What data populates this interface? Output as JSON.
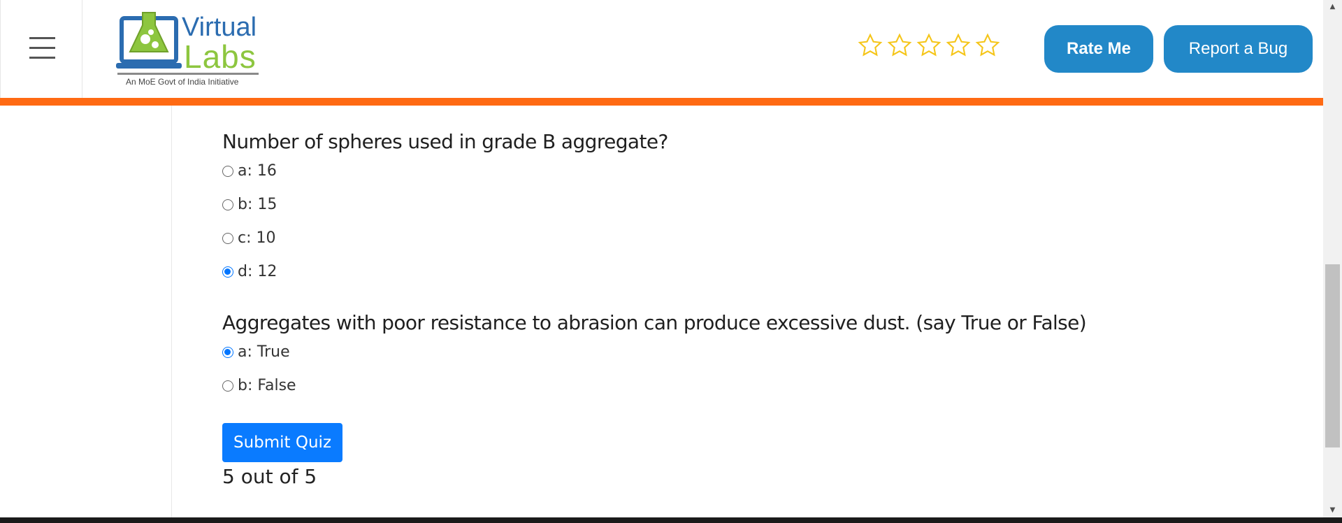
{
  "header": {
    "logo": {
      "word1": "Virtual",
      "word2": "Labs",
      "tagline": "An MoE Govt of India Initiative"
    },
    "rating": {
      "stars_total": 5,
      "stars_filled": 0,
      "star_color": "#f5c518"
    },
    "rate_button": "Rate Me",
    "bug_button": "Report a Bug",
    "accent_color": "#ff6a13",
    "button_color": "#2288c8"
  },
  "quiz": {
    "questions": [
      {
        "text": "Number of spheres used in grade B aggregate?",
        "options": [
          {
            "label": "a: 16",
            "selected": false
          },
          {
            "label": "b: 15",
            "selected": false
          },
          {
            "label": "c: 10",
            "selected": false
          },
          {
            "label": "d: 12",
            "selected": true
          }
        ]
      },
      {
        "text": "Aggregates with poor resistance to abrasion can produce excessive dust. (say True or False)",
        "options": [
          {
            "label": "a: True",
            "selected": true
          },
          {
            "label": "b: False",
            "selected": false
          }
        ]
      }
    ],
    "submit_label": "Submit Quiz",
    "score": "5 out of 5"
  }
}
